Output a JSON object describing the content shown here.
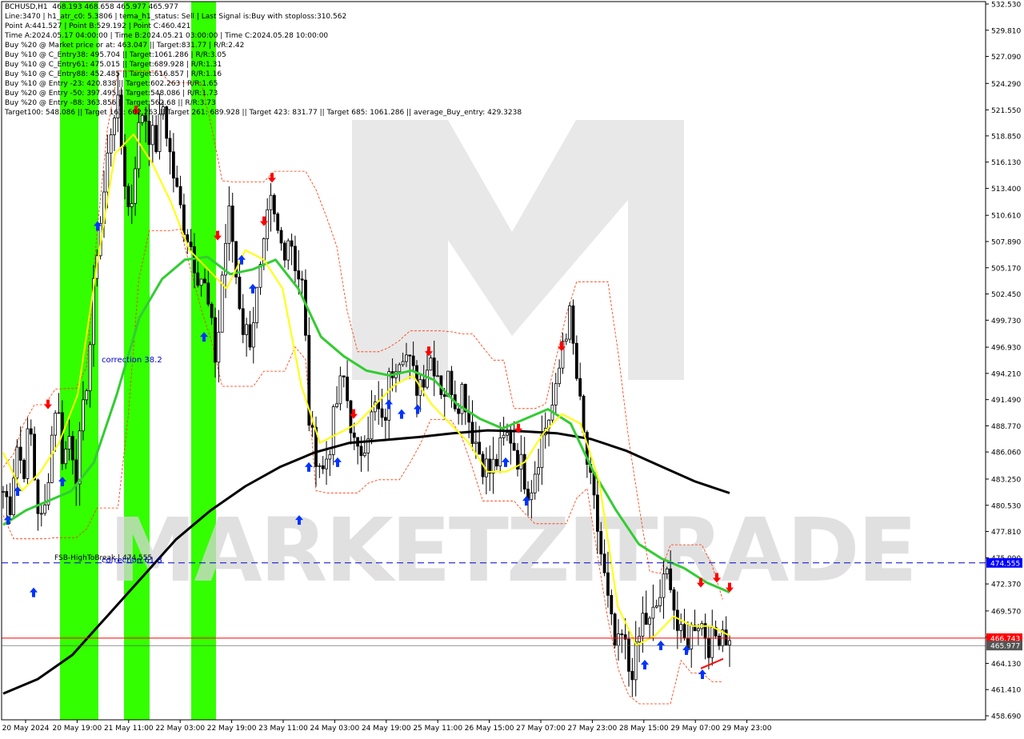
{
  "colors": {
    "bg": "#ffffff",
    "candle": "#000000",
    "sma_black": "#000000",
    "ma_green": "#33cc33",
    "fast_yellow": "#ffff00",
    "zone_green": "#33ff00",
    "channel_red": "#ff3300",
    "buy_arrow": "#0033ff",
    "sell_arrow": "#ff0000",
    "hline_red": "#ff0000",
    "hline_blue": "#0000cc",
    "label_blue": "#0000cc",
    "price_tag_dark": "#555555",
    "price_tag_red": "#ff0000",
    "price_tag_blue": "#0000ff",
    "watermark": "#d6d6d6"
  },
  "header_lines": [
    "BCHUSD,H1  468.193 468.658 465.977 465.977",
    "Line:3470 | h1_atr_c0: 5.3806 | tema_h1_status: Sell | Last Signal is:Buy with stoploss:310.562",
    "Point A:441.527 | Point B:529.192 | Point C:460.421",
    "Time A:2024.05.17 04:00:00 | Time B:2024.05.21 03:00:00 | Time C:2024.05.28 10:00:00",
    "Buy %20 @ Market price or at: 463.047 || Target:831.77 | R/R:2.42",
    "Buy %10 @ C_Entry38: 495.704 || Target:1061.286 | R/R:3.05",
    "Buy %10 @ C_Entry61: 475.015 || Target:689.928 | R/R:1.31",
    "Buy %10 @ C_Entry88: 452.485 || Target:616.857 | R/R:1.16",
    "Buy %10 @ Entry -23: 420.838 || Target:602.263 | R/R:1.65",
    "Buy %20 @ Entry -50: 397.495 || Target:548.086 | R/R:1.73",
    "Buy %20 @ Entry -88: 363.856 || Target:562.68 || R/R:3.73",
    "Target100: 548.086 || Target 161: 602.263 || Target 261: 689.928 || Target 423: 831.77 || Target 685: 1061.286 || average_Buy_entry: 429.3238"
  ],
  "watermark_text": "MARKETZITRADE",
  "chart_data": {
    "type": "candlestick",
    "symbol": "BCHUSD",
    "timeframe": "H1",
    "ylim": [
      458.69,
      533.9
    ],
    "y_ticks": [
      532.53,
      529.81,
      527.09,
      524.29,
      521.55,
      518.85,
      516.13,
      513.4,
      510.61,
      507.89,
      505.17,
      502.45,
      499.73,
      496.93,
      494.21,
      491.49,
      488.77,
      486.06,
      483.25,
      480.53,
      477.81,
      475.09,
      472.37,
      469.57,
      466.85,
      464.13,
      461.41,
      458.69
    ],
    "x_labels": [
      "20 May 2024",
      "20 May 19:00",
      "21 May 11:00",
      "22 May 03:00",
      "22 May 19:00",
      "23 May 11:00",
      "24 May 03:00",
      "24 May 19:00",
      "25 May 11:00",
      "26 May 15:00",
      "27 May 07:00",
      "27 May 23:00",
      "28 May 15:00",
      "29 May 07:00",
      "29 May 23:00"
    ],
    "close_path": [
      482,
      480.5,
      487,
      484,
      489,
      481,
      478,
      486,
      492,
      485,
      488,
      484,
      490,
      497,
      507,
      512,
      519,
      523,
      516,
      510,
      518,
      522,
      519,
      518,
      522,
      517,
      513,
      510,
      508,
      505,
      504,
      500,
      495,
      506,
      511,
      504,
      499,
      498,
      502,
      506,
      512,
      509,
      507,
      509,
      505,
      503,
      488,
      486,
      484,
      487,
      491,
      494,
      490,
      485,
      487,
      489,
      491,
      488,
      494,
      496,
      497,
      495,
      493,
      494,
      496,
      495,
      492,
      494,
      491,
      493,
      489,
      487,
      485,
      484,
      485,
      487,
      488,
      486,
      484,
      482,
      485,
      488,
      490,
      492,
      498,
      500,
      494,
      488,
      483,
      479,
      474,
      469,
      465,
      467,
      463,
      465,
      469,
      468,
      470,
      472,
      474,
      468,
      466,
      467,
      469,
      468,
      466,
      467,
      468,
      466
    ],
    "sma_long": [
      461,
      462.5,
      465,
      469,
      473,
      477,
      480,
      482.5,
      484.5,
      486,
      487,
      487.3,
      487.6,
      488,
      488.3,
      488.2,
      488,
      487.4,
      486.2,
      484.6,
      483,
      481.8
    ],
    "ma_green": [
      478.5,
      480,
      481,
      482,
      485,
      492,
      500,
      504,
      506,
      506.3,
      504.5,
      505,
      506,
      503,
      498,
      496,
      494.5,
      494,
      494.5,
      493.5,
      491,
      489.5,
      488.5,
      489.5,
      490.5,
      489,
      484,
      480,
      476.5,
      475,
      474,
      472.5,
      471.5
    ],
    "fast_yellow": [
      486,
      482,
      484,
      487,
      492,
      505,
      517,
      519,
      516,
      512,
      507,
      505,
      503,
      507,
      506,
      503,
      493,
      487,
      488,
      489,
      491,
      493,
      494,
      491,
      489,
      487,
      484,
      484,
      485,
      488,
      490,
      489,
      483,
      470,
      466,
      467,
      469,
      468,
      468,
      467
    ],
    "hlines": [
      {
        "label": "FSB-HighToBreak | 474.555",
        "value": 474.555,
        "style": "dashed",
        "color": "blue"
      },
      {
        "value": 466.743,
        "style": "solid",
        "color": "red"
      },
      {
        "value": 465.977,
        "style": "solid",
        "color": "dark"
      }
    ],
    "price_tags": [
      {
        "text": "474.555",
        "value": 474.555,
        "kind": "blue"
      },
      {
        "text": "466.743",
        "value": 466.743,
        "kind": "red"
      },
      {
        "text": "465.977",
        "value": 465.977,
        "kind": "dark"
      }
    ],
    "annotations": [
      {
        "text": "correction 38.2",
        "value": 495.7
      },
      {
        "text": "correction 61.8",
        "value": 474.9
      }
    ],
    "green_zones": [
      {
        "from_label": "20 May 19:00",
        "to_label": "21 May 11:00",
        "parts": 2
      },
      {
        "from_label": "22 May 19:00",
        "to_label": "22 May 19:00",
        "parts": 1
      }
    ],
    "grid": false,
    "legend": "none"
  }
}
